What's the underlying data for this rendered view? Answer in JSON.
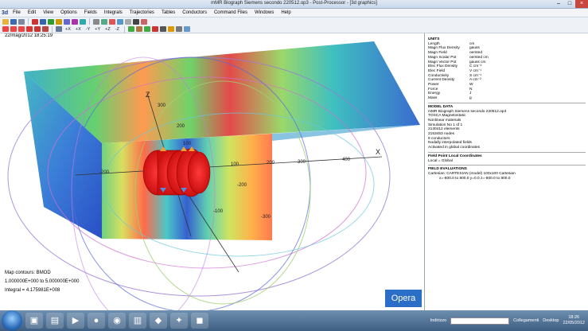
{
  "window": {
    "title": "mMR Biograph Siemens secondo 220512.op3 - Post-Processor - [3d graphics]"
  },
  "menu": {
    "logo": "3d",
    "items": [
      "File",
      "Edit",
      "View",
      "Options",
      "Fields",
      "Integrals",
      "Trajectories",
      "Tables",
      "Conductors",
      "Command Files",
      "Windows",
      "Help"
    ]
  },
  "toolbar": {
    "view_axes": [
      "+X",
      "+X",
      "-Y",
      "+Y",
      "+Z",
      "-Z"
    ]
  },
  "viewport": {
    "datetime": "22/mag/2012 18:25:19",
    "axis_labels": {
      "x": "X",
      "z": "Z"
    },
    "ticks_x": [
      "-200",
      "100",
      "200",
      "300",
      "400"
    ],
    "ticks_z": [
      "300",
      "200",
      "100"
    ],
    "ticks_neg": [
      "-100",
      "-200",
      "-300"
    ],
    "map_contours_label": "Map contours: BMOD",
    "map_range": "1.000000E+000 to 5.000000E+000",
    "integral": "Integral = 4.175981E+008",
    "logo": "Opera"
  },
  "side": {
    "units_title": "UNITS",
    "units": [
      [
        "Length",
        "cm"
      ],
      [
        "Magn Flux Density",
        "gauss"
      ],
      [
        "Magn Field",
        "oersted"
      ],
      [
        "Magn Scalar Pot",
        "oersted cm"
      ],
      [
        "Magn Vector Pot",
        "gauss cm"
      ],
      [
        "Elec Flux Density",
        "C cm⁻²"
      ],
      [
        "Elec Field",
        "V cm⁻¹"
      ],
      [
        "Conductivity",
        "S cm⁻¹"
      ],
      [
        "Current Density",
        "A cm⁻²"
      ],
      [
        "Power",
        "W"
      ],
      [
        "Force",
        "N"
      ],
      [
        "Energy",
        "J"
      ],
      [
        "Mass",
        "g"
      ]
    ],
    "model_title": "MODEL DATA",
    "model": [
      "mMR Biograph Siemens secondo 220512.op3",
      "TOSCA Magnetostatic",
      "Nonlinear materials",
      "Simulation No 1 of 1",
      "2130412 elements",
      "2153453 nodes",
      "8 conductors",
      "Nodally interpolated fields",
      "Activated in global coordinates"
    ],
    "fpl_title": "Field Point Local Coordinates",
    "fpl": "Local = Global",
    "fe_title": "FIELD EVALUATIONS",
    "fe": [
      "Cartesian: CARTESIAN (model) 100x100   Cartesian",
      "x=-800.0 to 800.0   y=0.0   z=-800.0 to 800.0"
    ]
  },
  "taskbar": {
    "indirizzo": "Indirizzo",
    "collegamenti": "Collegamenti",
    "desktop": "Desktop",
    "time": "18:26",
    "date": "22/05/2012"
  }
}
